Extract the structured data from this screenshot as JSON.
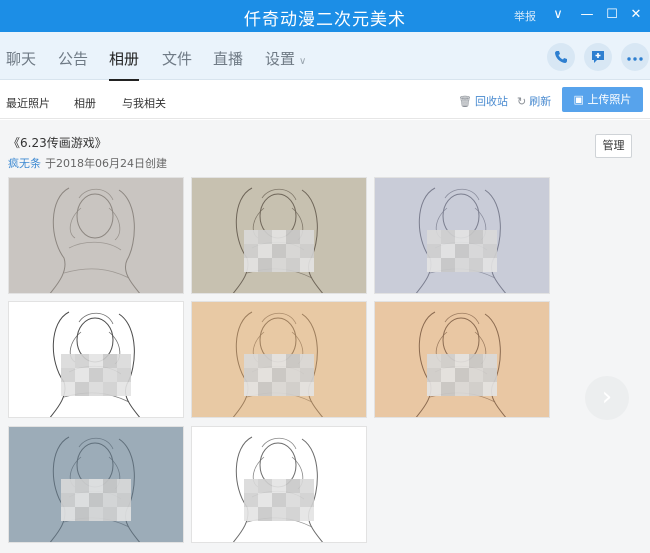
{
  "window": {
    "title": "仟奇动漫二次元美术",
    "report_label": "举报",
    "controls": {
      "dropdown": "∨",
      "minimize": "—",
      "maximize": "☐",
      "close": "✕"
    }
  },
  "tabs": [
    {
      "label": "聊天"
    },
    {
      "label": "公告"
    },
    {
      "label": "相册",
      "active": true
    },
    {
      "label": "文件"
    },
    {
      "label": "直播"
    },
    {
      "label": "设置",
      "has_dropdown": true
    }
  ],
  "header_actions": {
    "call_icon": "phone-icon",
    "add_icon": "plus-chat-icon",
    "more_icon": "more-dots-icon"
  },
  "subnav": {
    "tabs": [
      "最近照片",
      "相册",
      "与我相关"
    ],
    "recycle_label": "回收站",
    "refresh_label": "刷新",
    "upload_label": "上传照片"
  },
  "album": {
    "title": "《6.23传画游戏》",
    "author": "疯无条",
    "meta": "于2018年06月24日创建",
    "manage_label": "管理"
  },
  "photos": [
    {
      "bg": "#c9c5c1",
      "stroke": "#8c8680",
      "mosaic": false
    },
    {
      "bg": "#c7c1b0",
      "stroke": "#6e6558",
      "mosaic": true
    },
    {
      "bg": "#c9ccd8",
      "stroke": "#7a7d8e",
      "mosaic": true
    },
    {
      "bg": "#ffffff",
      "stroke": "#4a4a4a",
      "mosaic": true
    },
    {
      "bg": "#e8c9a4",
      "stroke": "#9c7d5c",
      "mosaic": true
    },
    {
      "bg": "#e9c7a3",
      "stroke": "#8a6a50",
      "mosaic": true
    },
    {
      "bg": "#9cacb8",
      "stroke": "#5f6e7a",
      "mosaic": true
    },
    {
      "bg": "#ffffff",
      "stroke": "#6a6a6a",
      "mosaic": true
    }
  ],
  "colors": {
    "accent": "#1c8ee6",
    "link": "#3e8ad2",
    "upload_button": "#57a3ec"
  }
}
